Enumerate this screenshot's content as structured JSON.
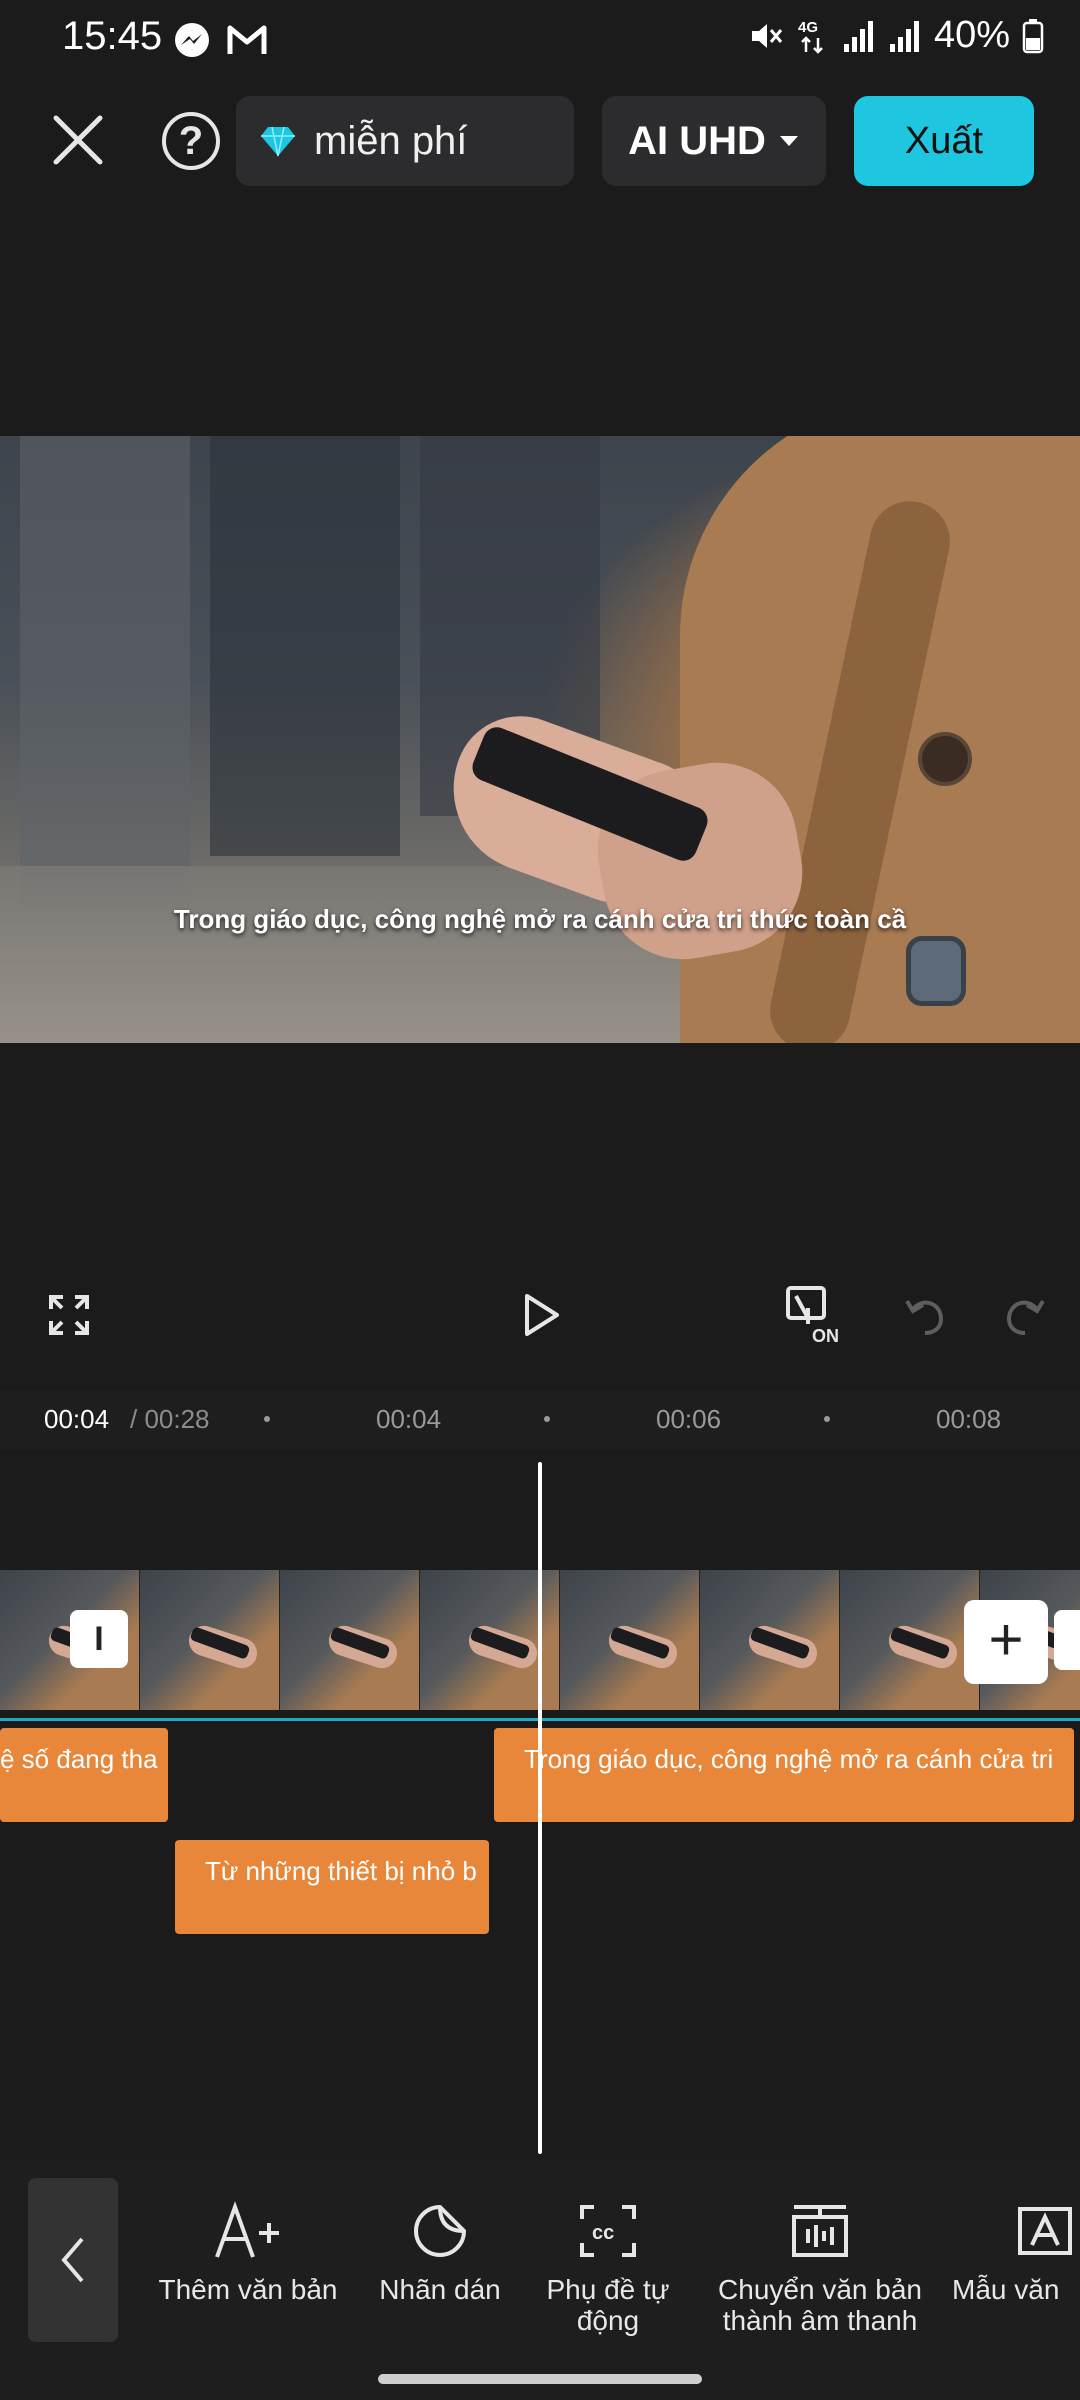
{
  "status_bar": {
    "time": "15:45",
    "battery": "40%",
    "network": "4G",
    "icons": [
      "messenger-icon",
      "gmail-icon",
      "mute-icon",
      "signal-icon",
      "signal-icon",
      "battery-icon"
    ]
  },
  "toolbar": {
    "pro_label": "miễn phí",
    "resolution_label": "AI UHD",
    "export_label": "Xuất",
    "help_label": "?"
  },
  "preview": {
    "subtitle": "Trong giáo dục, công nghệ mở ra cánh cửa tri thức toàn cầ"
  },
  "controls": {
    "cc_badge": "ON"
  },
  "ruler": {
    "current_time": "00:04",
    "total_time": " / 00:28",
    "ticks": [
      "00:04",
      "00:06",
      "00:08"
    ]
  },
  "timeline": {
    "clip_handle_label": "I",
    "add_clip_label": "+",
    "text_clips": [
      "ệ số đang tha",
      "Từ những thiết bị nhỏ b",
      "Trong giáo dục, công nghệ mở ra cánh cửa tri"
    ]
  },
  "bottom_tools": [
    {
      "label": "Thêm văn bản",
      "icon": "add-text-icon"
    },
    {
      "label": "Nhãn dán",
      "icon": "sticker-icon"
    },
    {
      "label": "Phụ đề tự động",
      "icon": "auto-captions-icon"
    },
    {
      "label": "Chuyển văn bản thành âm thanh",
      "icon": "text-to-speech-icon"
    },
    {
      "label": "Mẫu văn",
      "icon": "text-template-icon"
    }
  ],
  "colors": {
    "accent": "#1fc6e0",
    "text_clip": "#e8873a",
    "background": "#1b1b1b"
  }
}
